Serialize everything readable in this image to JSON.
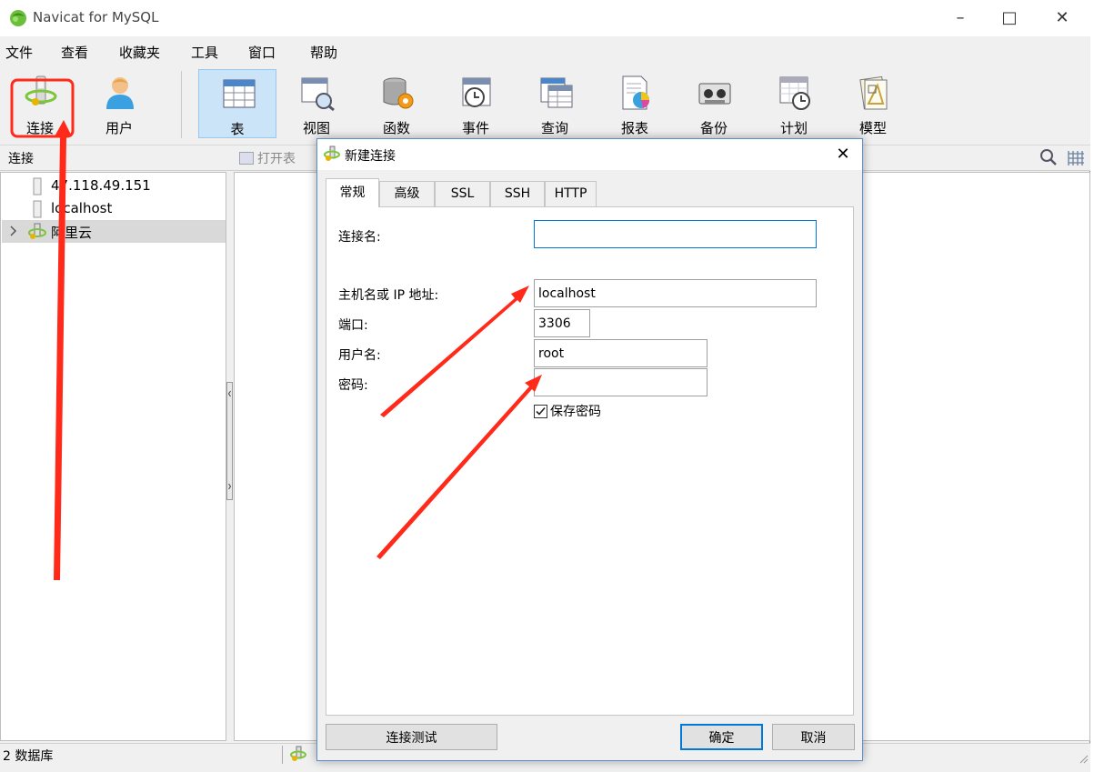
{
  "window": {
    "title": "Navicat for MySQL"
  },
  "menu": [
    "文件",
    "查看",
    "收藏夹",
    "工具",
    "窗口",
    "帮助"
  ],
  "toolbar": [
    "连接",
    "用户",
    "表",
    "视图",
    "函数",
    "事件",
    "查询",
    "报表",
    "备份",
    "计划",
    "模型"
  ],
  "subbar": {
    "title": "连接",
    "open_table": "打开表"
  },
  "tree": [
    "47.118.49.151",
    "localhost",
    "阿里云"
  ],
  "status": {
    "count": "2 数据库"
  },
  "dialog": {
    "title": "新建连接",
    "tabs": [
      "常规",
      "高级",
      "SSL",
      "SSH",
      "HTTP"
    ],
    "labels": {
      "conn_name": "连接名:",
      "host": "主机名或 IP 地址:",
      "port": "端口:",
      "user": "用户名:",
      "password": "密码:"
    },
    "values": {
      "conn_name": "",
      "host": "localhost",
      "port": "3306",
      "user": "root",
      "password": ""
    },
    "save_password": "保存密码",
    "buttons": {
      "test": "连接测试",
      "ok": "确定",
      "cancel": "取消"
    }
  },
  "colors": {
    "accent": "#0078d7",
    "annotation": "#ff2a1a",
    "active_tool": "#cce4f7"
  }
}
